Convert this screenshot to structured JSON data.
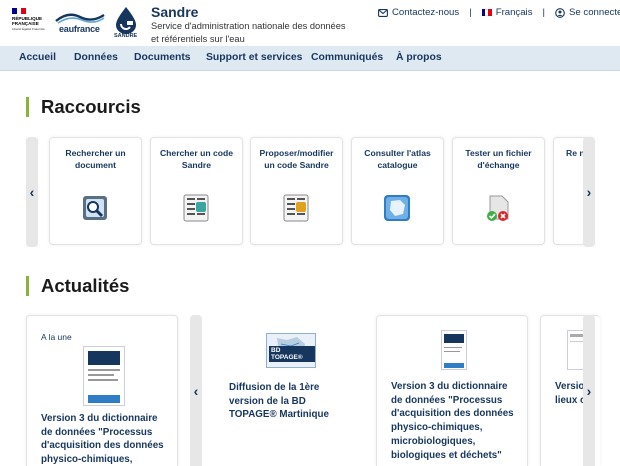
{
  "header": {
    "rf_logo_lines": [
      "RÉPUBLIQUE",
      "FRANÇAISE"
    ],
    "rf_logo_motto": "Liberté Égalité Fraternité",
    "eaufrance_logo": "eaufrance",
    "sandre_logo": "SANDRE",
    "site_title": "Sandre",
    "site_desc": "Service d'administration nationale des données et référentiels sur l'eau",
    "contact_label": "Contactez-nous",
    "language_label": "Français",
    "login_label": "Se connecter",
    "separator": "|"
  },
  "nav": {
    "items": [
      "Accueil",
      "Données",
      "Documents",
      "Support et services",
      "Communiqués",
      "À propos"
    ]
  },
  "shortcuts": {
    "title": "Raccourcis",
    "items": [
      {
        "label": "Rechercher un document",
        "icon": "document-search-icon"
      },
      {
        "label": "Chercher un code Sandre",
        "icon": "code-table-icon"
      },
      {
        "label": "Proposer/modifier un code Sandre",
        "icon": "code-edit-icon"
      },
      {
        "label": "Consulter l'atlas catalogue",
        "icon": "atlas-map-icon"
      },
      {
        "label": "Tester un fichier d'échange",
        "icon": "file-test-icon"
      },
      {
        "label": "Re no"
      }
    ],
    "prev_symbol": "‹",
    "next_symbol": "›"
  },
  "news": {
    "title": "Actualités",
    "items": [
      {
        "tag": "A la une",
        "title": "Version 3 du dictionnaire de données \"Processus d'acquisition des données physico-chimiques,"
      },
      {
        "badge": "BD TOPAGE®",
        "title": "Diffusion de la 1ère version de la BD TOPAGE® Martinique"
      },
      {
        "title": "Version 3 du dictionnaire de données \"Processus d'acquisition des données physico-chimiques, microbiologiques, biologiques et déchets\""
      },
      {
        "title": "Versio lieux c"
      }
    ],
    "prev_symbol": "‹",
    "next_symbol": "›"
  },
  "colors": {
    "primary": "#17365d",
    "accent": "#8bb33a",
    "nav_bg": "#dfe9f2"
  }
}
